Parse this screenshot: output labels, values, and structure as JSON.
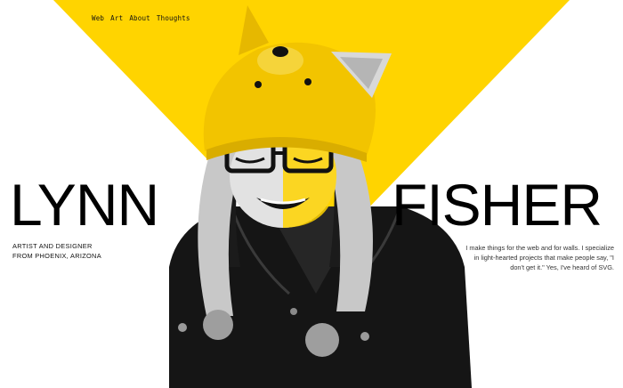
{
  "nav": {
    "items": [
      {
        "label": "Web"
      },
      {
        "label": "Art"
      },
      {
        "label": "About"
      },
      {
        "label": "Thoughts"
      }
    ]
  },
  "hero": {
    "first_name": "LYNN",
    "last_name": "FISHER",
    "tagline": "ARTIST AND DESIGNER\nFROM PHOENIX, ARIZONA",
    "bio": "I make things for the web and for walls. I specialize in light-hearted projects that make people say, \"I don't get it.\" Yes, I've heard of SVG."
  },
  "colors": {
    "accent_yellow": "#ffd400",
    "background": "#ffffff",
    "text": "#000000"
  },
  "icons": {
    "portrait": "person-in-wolf-hat-photo"
  }
}
